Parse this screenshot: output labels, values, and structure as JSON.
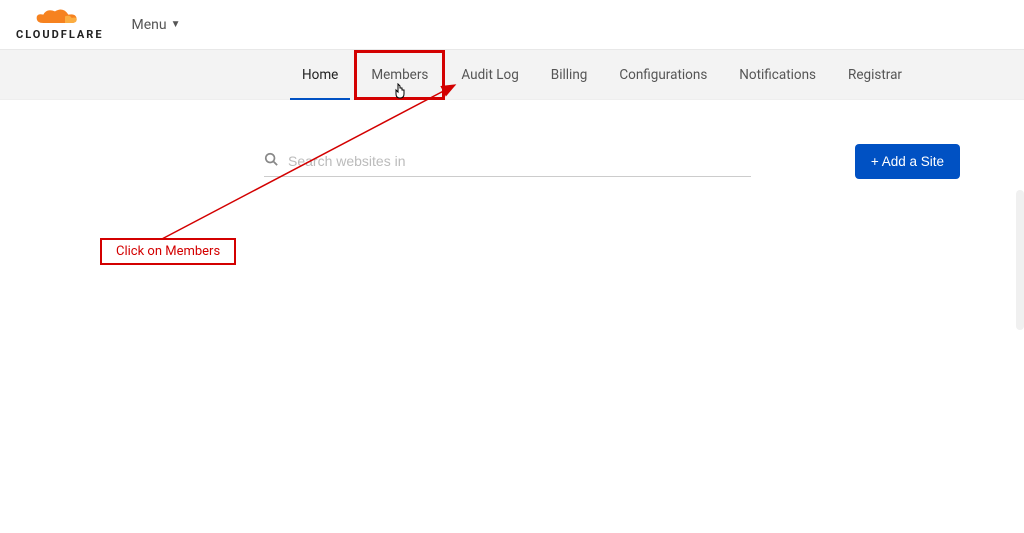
{
  "header": {
    "logo_text": "CLOUDFLARE",
    "menu_label": "Menu"
  },
  "nav": {
    "items": [
      {
        "label": "Home"
      },
      {
        "label": "Members"
      },
      {
        "label": "Audit Log"
      },
      {
        "label": "Billing"
      },
      {
        "label": "Configurations"
      },
      {
        "label": "Notifications"
      },
      {
        "label": "Registrar"
      }
    ]
  },
  "search": {
    "placeholder": "Search websites in"
  },
  "actions": {
    "add_site_label": "+ Add a Site"
  },
  "annotation": {
    "callout_text": "Click on Members"
  }
}
